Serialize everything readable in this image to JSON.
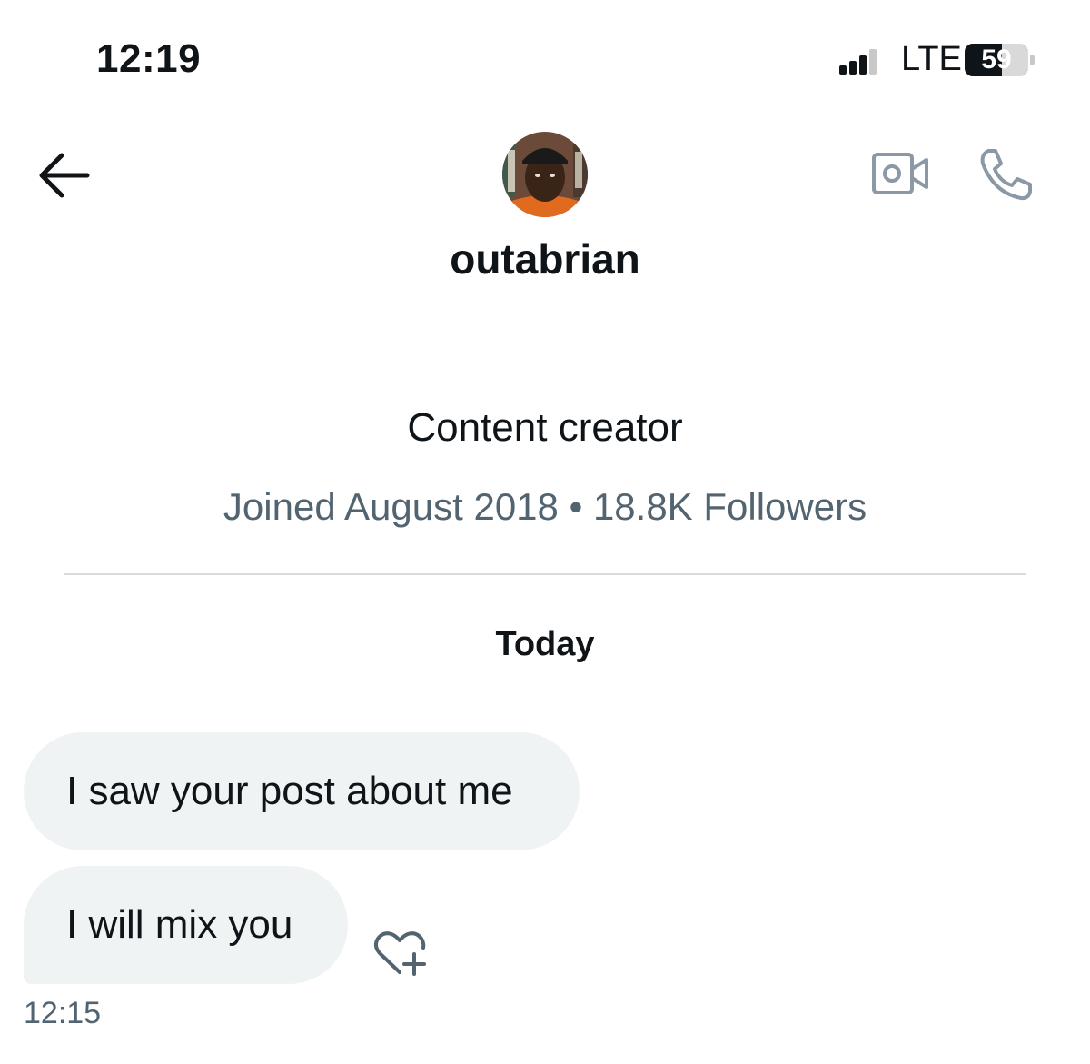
{
  "status_bar": {
    "time": "12:19",
    "network": "LTE",
    "battery_percent": "59",
    "battery_level": 0.59,
    "signal_bars_active": 3,
    "signal_bars_total": 4
  },
  "header": {
    "back_icon": "arrow-left-icon",
    "video_icon": "video-camera-icon",
    "phone_icon": "phone-icon"
  },
  "profile": {
    "username": "outabrian",
    "bio": "Content creator",
    "meta": "Joined August 2018 • 18.8K Followers"
  },
  "conversation": {
    "day_label": "Today",
    "messages": [
      {
        "text": "I saw your post about me"
      },
      {
        "text": "I will mix you",
        "time": "12:15"
      }
    ],
    "react_icon": "heart-plus-icon"
  },
  "colors": {
    "text_primary": "#0f1419",
    "text_secondary": "#536471",
    "bubble_bg": "#eff3f4",
    "divider": "#d5dadf",
    "icon_grey": "#8b98a5"
  }
}
